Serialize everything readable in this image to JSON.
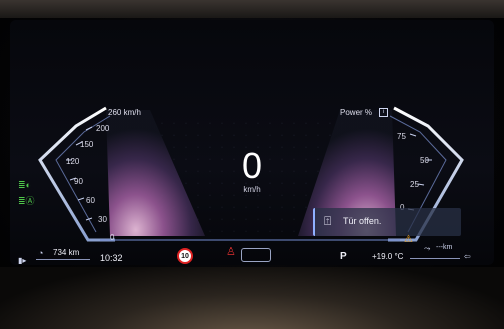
{
  "cluster": {
    "speed_value": "0",
    "speed_unit": "km/h",
    "left_gauge": {
      "unit_label": "260 km/h",
      "ticks": [
        "200",
        "150",
        "120",
        "90",
        "60",
        "30",
        "0"
      ]
    },
    "right_gauge": {
      "title": "Power %",
      "ticks": [
        "75",
        "50",
        "25",
        "0"
      ]
    },
    "notification": {
      "text": "Tür offen."
    },
    "status_bar": {
      "range_km": "734 km",
      "time": "10:32",
      "speed_limit": "10",
      "gear": "P",
      "temperature": "+19.0 °C",
      "trip_km": "---km"
    },
    "colors": {
      "accent_blue": "#8fb0ff",
      "indicator_green": "#4fc64a",
      "warning_amber": "#e8a020",
      "seatbelt_red": "#e03030"
    }
  }
}
